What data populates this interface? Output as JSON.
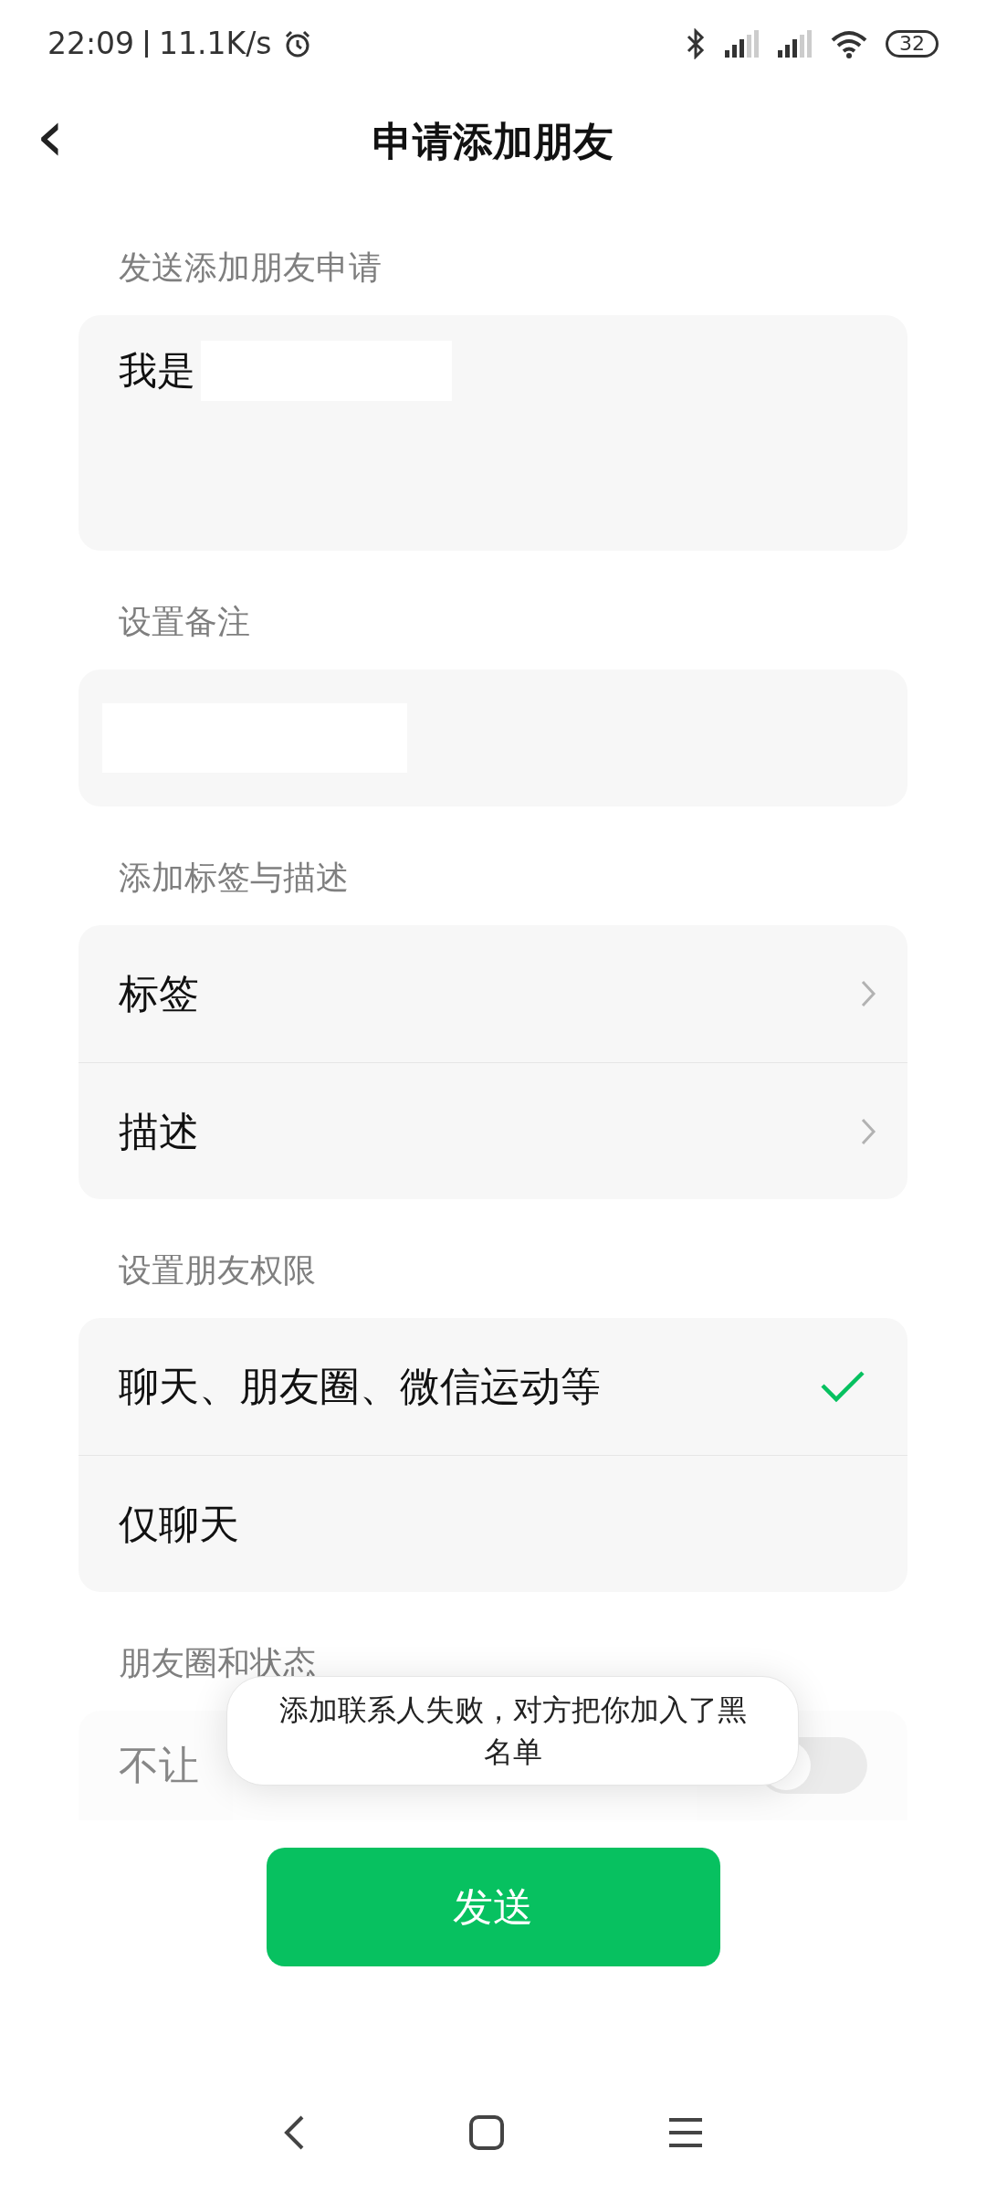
{
  "status_bar": {
    "time": "22:09",
    "speed": "11.1K/s",
    "battery": "32"
  },
  "header": {
    "back": "‹",
    "title": "申请添加朋友"
  },
  "request": {
    "label": "发送添加朋友申请",
    "value": "我是"
  },
  "remark": {
    "label": "设置备注"
  },
  "tags_section": {
    "label": "添加标签与描述",
    "items": [
      {
        "label": "标签"
      },
      {
        "label": "描述"
      }
    ]
  },
  "permissions": {
    "label": "设置朋友权限",
    "options": [
      {
        "label": "聊天、朋友圈、微信运动等",
        "selected": true
      },
      {
        "label": "仅聊天",
        "selected": false
      }
    ]
  },
  "moments": {
    "label": "朋友圈和状态",
    "toggle": {
      "label": "不让",
      "on": false
    }
  },
  "toast": {
    "text": "添加联系人失败，对方把你加入了黑名单"
  },
  "send_button": {
    "label": "发送"
  }
}
